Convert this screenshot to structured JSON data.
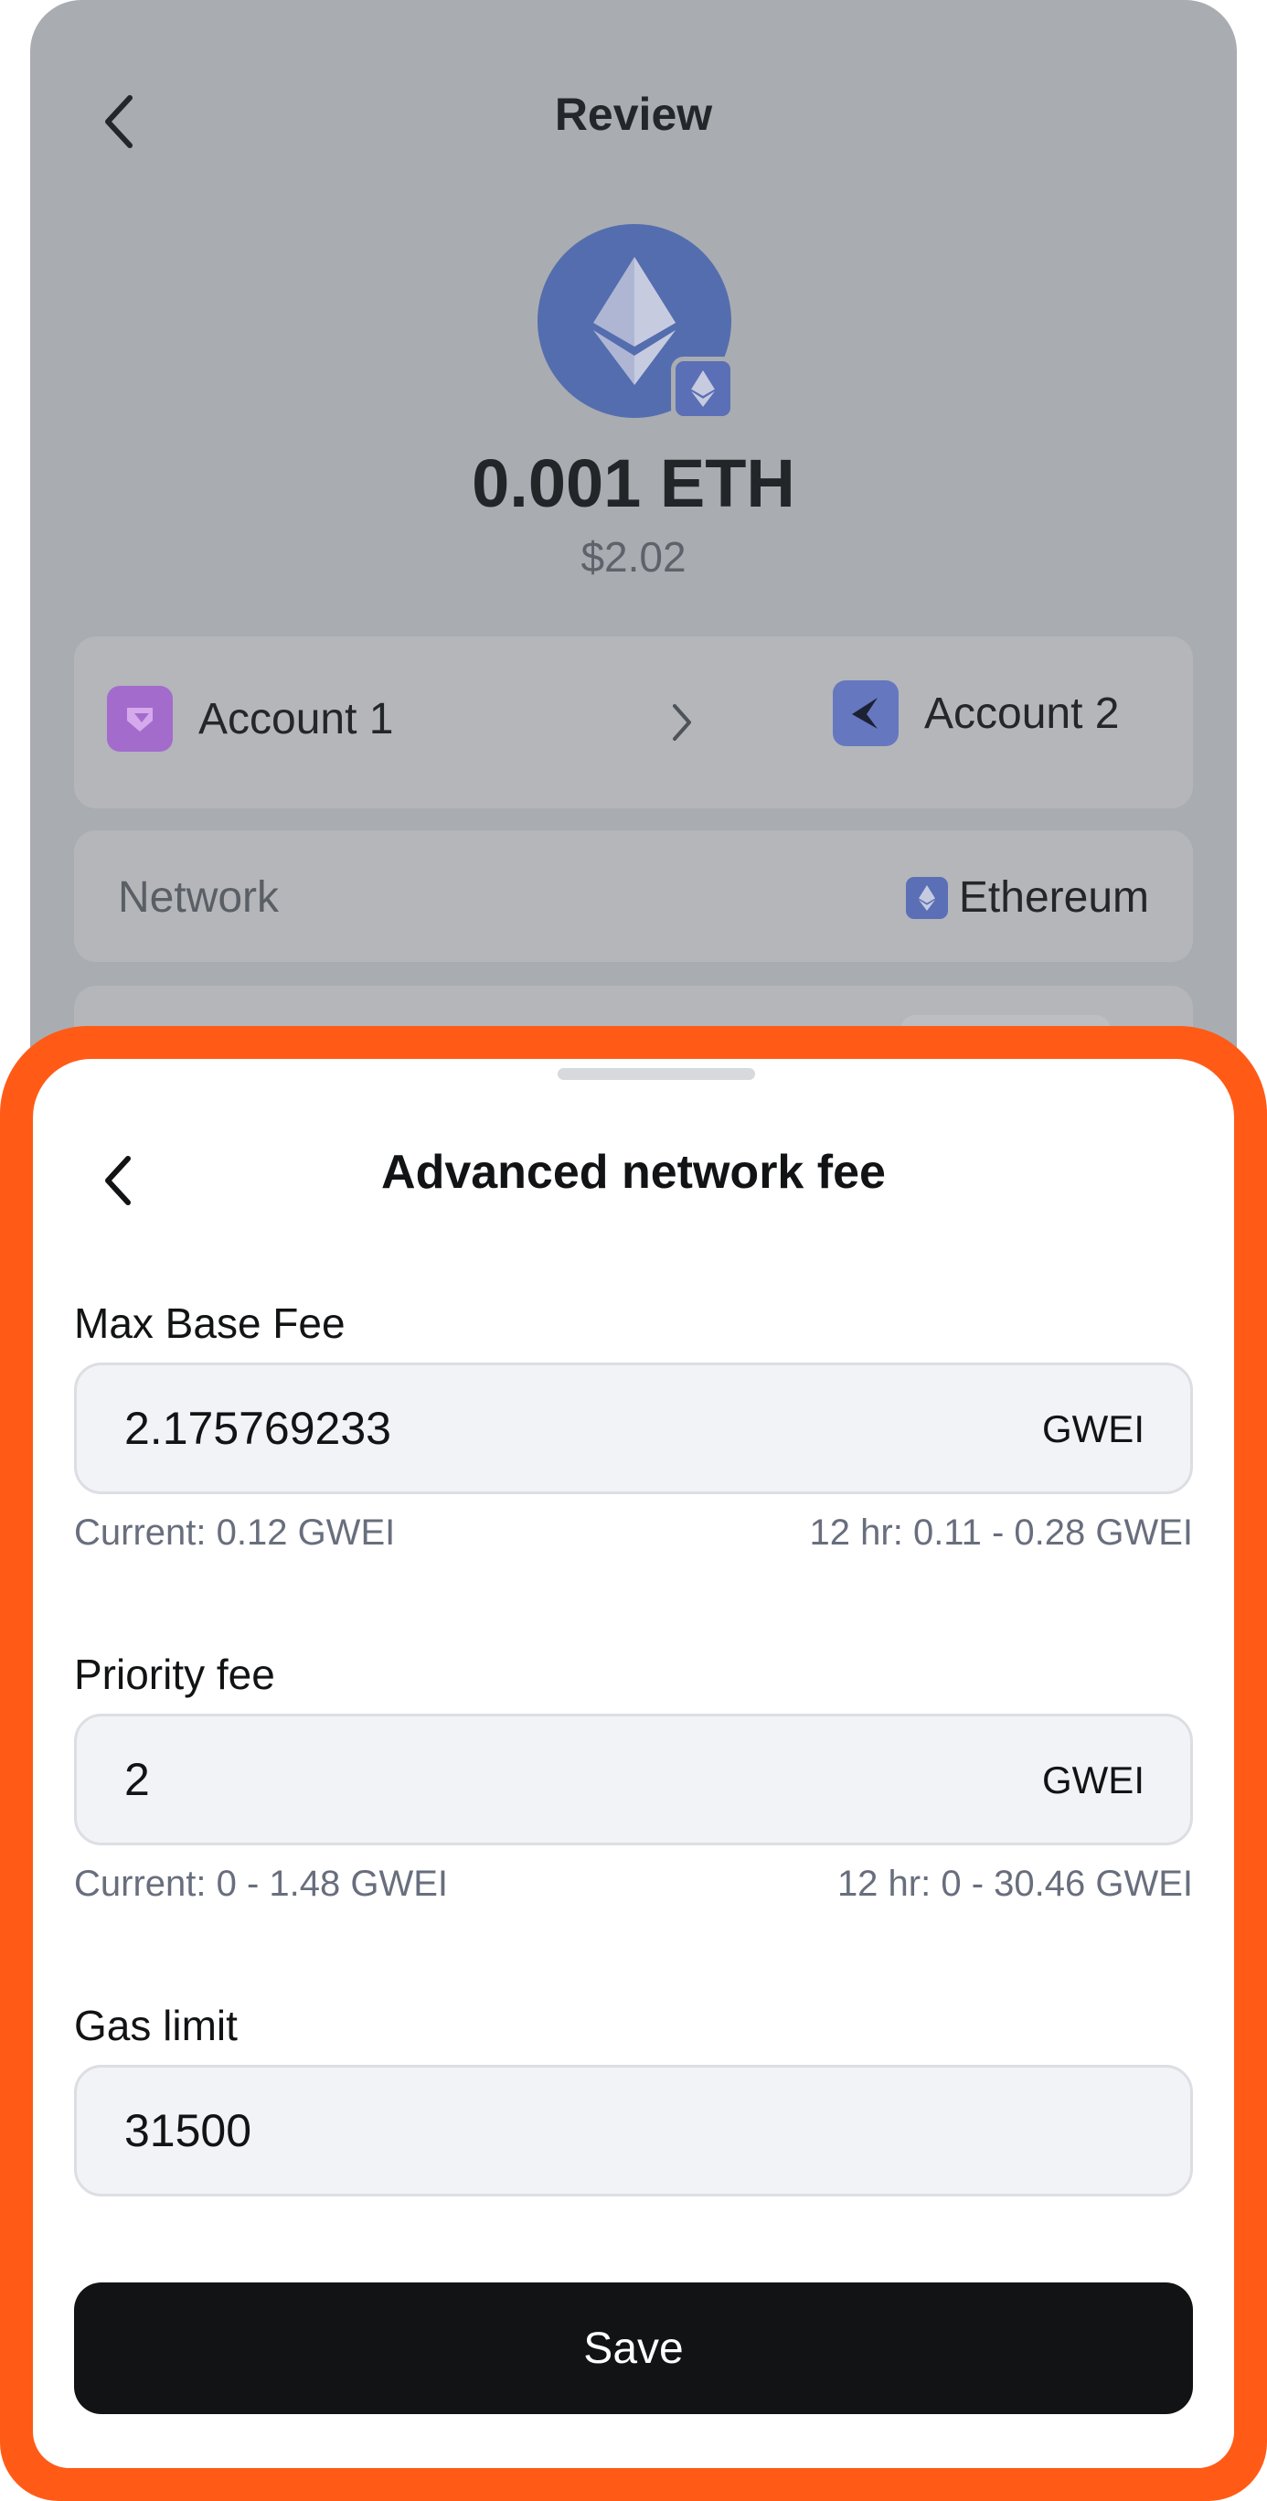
{
  "review": {
    "title": "Review",
    "amount": "0.001 ETH",
    "amount_fiat": "$2.02",
    "from_account": "Account 1",
    "to_account": "Account 2",
    "network_label": "Network",
    "network_value": "Ethereum",
    "token_icon": "ethereum-icon"
  },
  "sheet": {
    "title": "Advanced network fee",
    "max_base_fee": {
      "label": "Max Base Fee",
      "value": "2.175769233",
      "unit": "GWEI",
      "current": "Current: 0.12 GWEI",
      "range": "12 hr: 0.11 - 0.28 GWEI"
    },
    "priority_fee": {
      "label": "Priority fee",
      "value": "2",
      "unit": "GWEI",
      "current": "Current: 0 - 1.48 GWEI",
      "range": "12 hr: 0 - 30.46 GWEI"
    },
    "gas_limit": {
      "label": "Gas limit",
      "value": "31500"
    },
    "save_label": "Save"
  },
  "colors": {
    "highlight_border": "#ff5b17",
    "primary_button": "#121314",
    "field_bg": "#f2f3f7",
    "hint_text": "#686e7d",
    "eth_blue": "#546dae"
  }
}
